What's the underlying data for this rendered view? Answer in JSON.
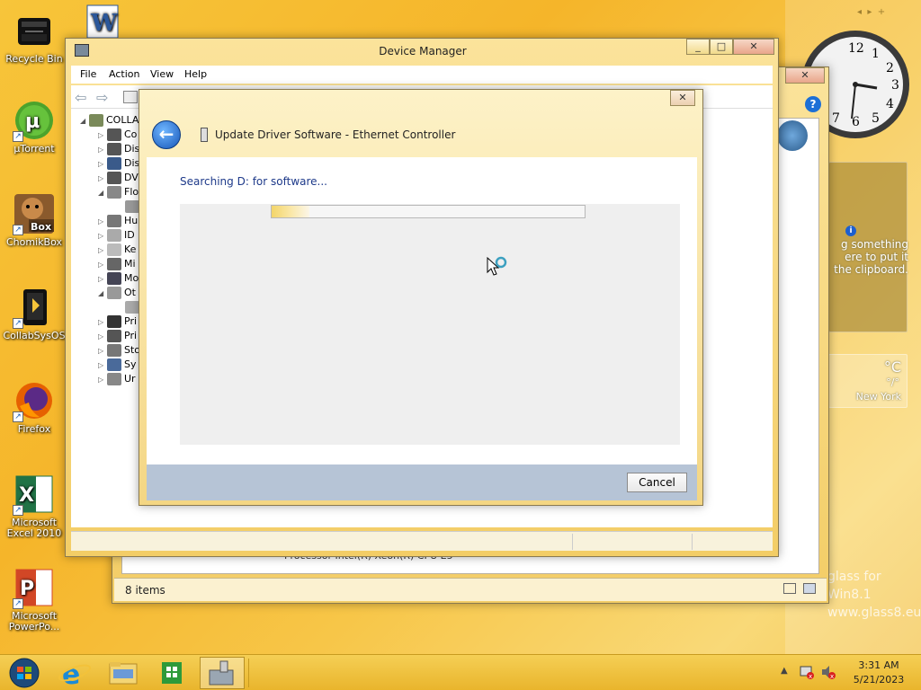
{
  "desktop_icons": [
    {
      "id": "recycle-bin",
      "label": "Recycle Bin"
    },
    {
      "id": "utorrent",
      "label": "µTorrent"
    },
    {
      "id": "chomikbox",
      "label": "ChomikBox"
    },
    {
      "id": "collabsysos",
      "label": "CollabSysOS"
    },
    {
      "id": "firefox",
      "label": "Firefox"
    },
    {
      "id": "excel",
      "label": "Microsoft Excel 2010"
    },
    {
      "id": "powerpoint",
      "label": "Microsoft PowerPo..."
    }
  ],
  "gadgets": {
    "clipboard_text": "g something ere to put it the clipboard.",
    "weather_unit": "°C",
    "weather_range": "°/°",
    "weather_city": "New York",
    "clock_numbers": [
      "12",
      "1",
      "2",
      "3",
      "4",
      "5",
      "6",
      "7"
    ]
  },
  "device_manager": {
    "title": "Device Manager",
    "menu": [
      "File",
      "Action",
      "View",
      "Help"
    ],
    "root_label": "COLLA",
    "tree": [
      "Co",
      "Dis",
      "Dis",
      "DV",
      "Flo",
      "",
      "Hu",
      "ID",
      "Ke",
      "Mi",
      "Mo",
      "Ot",
      "",
      "Pri",
      "Pri",
      "Sto",
      "Sy",
      "Ur"
    ]
  },
  "explorer_back": {
    "status": "8 items",
    "row_text": "Processor   Intel(R) Xeon(R) CPU E5"
  },
  "update_driver": {
    "title": "Update Driver Software - Ethernet Controller",
    "status": "Searching D: for software...",
    "progress": 0.12,
    "cancel_label": "Cancel"
  },
  "watermark": {
    "line1": "glass for Win8.1",
    "line2": "www.glass8.eu"
  },
  "taskbar": {
    "time": "3:31 AM",
    "date": "5/21/2023"
  }
}
